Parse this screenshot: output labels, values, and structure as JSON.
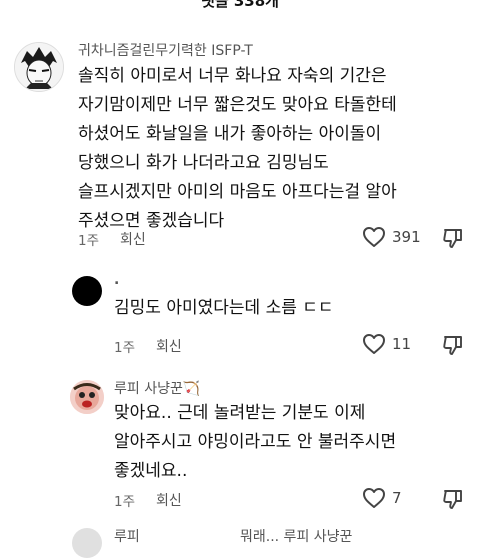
{
  "header": {
    "partial_text": "댓글 338개"
  },
  "comments": [
    {
      "username": "귀차니즘걸린무기력한 ISFP-T",
      "text": "솔직히 아미로서 너무 화나요 자숙의 기간은\n자기맘이제만 너무 짧은것도 맞아요 타돌한테\n하셨어도 화날일을 내가 좋아하는 아이돌이\n당했으니 화가 나더라고요 김밍님도\n슬프시겠지만 아미의 마음도 아프다는걸 알아\n주셨으면 좋겠습니다",
      "time": "1주",
      "reply_label": "회신",
      "likes": "391"
    },
    {
      "username": ".",
      "text": "김밍도 아미였다는데 소름 ㄷㄷ",
      "time": "1주",
      "reply_label": "회신",
      "likes": "11"
    },
    {
      "username": "루피 사냥꾼🏹",
      "text": "맞아요.. 근데 놀려받는 기분도 이제\n알아주시고 야밍이라고도 안 불러주시면\n좋겠네요..",
      "time": "1주",
      "reply_label": "회신",
      "likes": "7"
    }
  ],
  "footer_partial": {
    "username": "루피",
    "text": "뭐래... 루피 사냥꾼"
  },
  "colors": {
    "text": "#111111",
    "muted": "#666666",
    "background": "#ffffff"
  },
  "icons": [
    "heart-outline-icon",
    "thumb-down-outline-icon"
  ]
}
